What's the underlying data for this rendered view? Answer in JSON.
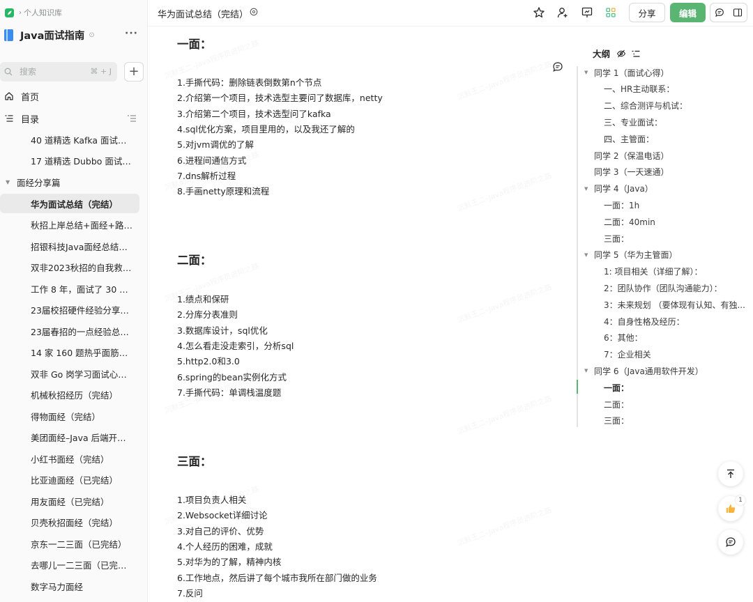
{
  "breadcrumb": {
    "root": "个人知识库"
  },
  "book": {
    "title": "Java面试指南",
    "more": "···"
  },
  "search": {
    "placeholder": "搜索",
    "shortcut": "⌘ + J"
  },
  "nav": {
    "home": "首页",
    "toc": "目录"
  },
  "tree": {
    "top_items": [
      "40 道精选 Kafka 面试题...",
      "17 道精选 Dubbo 面试题..."
    ],
    "group": "面经分享篇",
    "items": [
      "华为面试总结（完结）",
      "秋招上岸总结+面经+路线...",
      "招银科技Java面经总结（...",
      "双非2023秋招的自我救赎...",
      "工作 8 年，面试了 30 家...",
      "23届校招硬件经验分享（...",
      "23届春招的一点经验总结...",
      "14 家 160 题热乎面筋（...",
      "双非 Go 岗学习面试心得...",
      "机械秋招经历（完结）",
      "得物面经（完结）",
      "美团面经–Java 后端开发...",
      "小红书面经（完结）",
      "比亚迪面经（已完结）",
      "用友面经（已完结）",
      "贝壳秋招面经（完结）",
      "京东一二三面（已完结）",
      "去哪儿一二三面（已完结）",
      "数字马力面经"
    ],
    "active_index": 0
  },
  "header": {
    "doc_title": "华为面试总结（完结）",
    "share_label": "分享",
    "edit_label": "编辑"
  },
  "doc": {
    "sections": [
      {
        "title": "一面：",
        "lines": [
          "1.手撕代码：删除链表倒数第n个节点",
          "2.介绍第一个项目，技术选型主要问了数据库，netty",
          "3.介绍第二个项目，技术选型问了kafka",
          "4.sql优化方案，项目里用的，以及我还了解的",
          "5.对jvm调优的了解",
          "6.进程间通信方式",
          "7.dns解析过程",
          "8.手画netty原理和流程"
        ]
      },
      {
        "title": "二面：",
        "lines": [
          "1.绩点和保研",
          "2.分库分表准则",
          "3.数据库设计，sql优化",
          "4.怎么看走没走索引，分析sql",
          "5.http2.0和3.0",
          "6.spring的bean实例化方式",
          "7.手撕代码：单调栈温度题"
        ]
      },
      {
        "title": "三面：",
        "lines": [
          "1.项目负责人相关",
          "2.Websocket详细讨论",
          "3.对自己的评价、优势",
          "4.个人经历的困难，成就",
          "5.对华为的了解，精神内核",
          "6.工作地点，然后讲了每个城市我所在部门做的业务",
          "7.反问"
        ]
      }
    ],
    "watermark": "沉默王二–Java程序员进阶之路"
  },
  "outline": {
    "title": "大纲",
    "items": [
      {
        "level": 1,
        "caret": true,
        "text": "同学 1（面试心得）"
      },
      {
        "level": 2,
        "text": "一、HR主动联系："
      },
      {
        "level": 2,
        "text": "二、综合测评与机试："
      },
      {
        "level": 2,
        "text": "三、专业面试："
      },
      {
        "level": 2,
        "text": "四、主管面："
      },
      {
        "level": 1,
        "caret": false,
        "text": "同学 2（保温电话）"
      },
      {
        "level": 1,
        "caret": false,
        "text": "同学 3（一天速通）"
      },
      {
        "level": 1,
        "caret": true,
        "text": "同学 4（Java）"
      },
      {
        "level": 2,
        "text": "一面：1h"
      },
      {
        "level": 2,
        "text": "二面：40min"
      },
      {
        "level": 2,
        "text": "三面："
      },
      {
        "level": 1,
        "caret": true,
        "text": "同学 5（华为主管面）"
      },
      {
        "level": 2,
        "text": "1: 项目相关（详细了解）："
      },
      {
        "level": 2,
        "text": "2：团队协作（团队沟通能力）："
      },
      {
        "level": 2,
        "text": "3：未来规划 （要体现有认知、有独..."
      },
      {
        "level": 2,
        "text": "4：自身性格及经历："
      },
      {
        "level": 2,
        "text": "6：其他："
      },
      {
        "level": 2,
        "text": "7：企业相关"
      },
      {
        "level": 1,
        "caret": true,
        "text": "同学 6（Java通用软件开发）"
      },
      {
        "level": 2,
        "text": "一面：",
        "bold": true
      },
      {
        "level": 2,
        "text": "二面："
      },
      {
        "level": 2,
        "text": "三面："
      }
    ]
  },
  "floating": {
    "like_count": "1"
  },
  "colors": {
    "accent": "#5ab573",
    "brand": "#25b864",
    "book": "#3a8cf3"
  }
}
